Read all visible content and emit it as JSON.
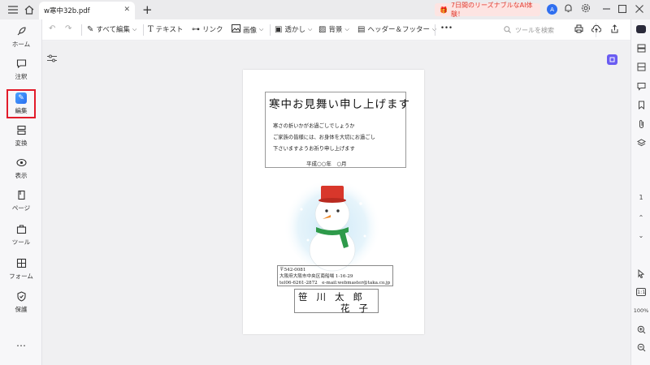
{
  "titlebar": {
    "tab_title": "w寒中32b.pdf",
    "promo_text": "7日間のリーズナブルなAI体験！",
    "user_initial": "A"
  },
  "sidebar": {
    "items": [
      {
        "label": "ホーム",
        "icon": "rocket-icon"
      },
      {
        "label": "注釈",
        "icon": "comment-icon"
      },
      {
        "label": "編集",
        "icon": "edit-icon"
      },
      {
        "label": "変換",
        "icon": "convert-icon"
      },
      {
        "label": "表示",
        "icon": "eye-icon"
      },
      {
        "label": "ページ",
        "icon": "page-icon"
      },
      {
        "label": "ツール",
        "icon": "toolbox-icon"
      },
      {
        "label": "フォーム",
        "icon": "form-icon"
      },
      {
        "label": "保護",
        "icon": "shield-icon"
      }
    ],
    "more": "⋯"
  },
  "toolbar": {
    "edit_all": "すべて編集",
    "text": "テキスト",
    "link": "リンク",
    "image": "画像",
    "watermark": "透かし",
    "background": "背景",
    "header_footer": "ヘッダー＆フッター",
    "more": "•••",
    "search_placeholder": "ツールを検索"
  },
  "rightbar": {
    "page_number": "1",
    "zoom": "100%",
    "fit_label": "1:1"
  },
  "document": {
    "title": "寒中お見舞い申し上げます",
    "lines": [
      "寒さの折いかがお過ごしでしょうか",
      "ご家族の皆様には、お身体を大切にお過ごし",
      "下さいますようお祈り申し上げます"
    ],
    "date": "平成○○年　○月",
    "address": [
      "〒542-0081",
      "大阪府大阪市中央区南船場 1-16-29",
      "tel06-6261-2872　e-mail:webmaster@taka.co.jp"
    ],
    "name_line1": "笹川太郎",
    "name_line2": "花子"
  },
  "colors": {
    "accent": "#2f6ff0",
    "active_border": "#e21b2a",
    "promo_text": "#e03a2f",
    "scarf": "#2e9a4a",
    "hat": "#d8372b",
    "nose": "#ef8a2a"
  }
}
